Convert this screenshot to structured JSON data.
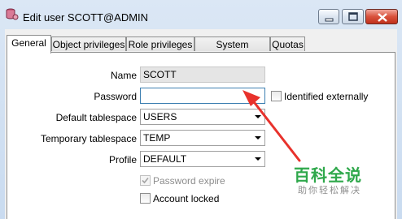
{
  "window": {
    "title": "Edit user SCOTT@ADMIN",
    "icon": "database-user-icon",
    "controls": [
      "minimize-icon",
      "maximize-icon",
      "close-icon"
    ]
  },
  "tabs": [
    {
      "label": "General",
      "active": true
    },
    {
      "label": "Object privileges",
      "active": false
    },
    {
      "label": "Role privileges",
      "active": false
    },
    {
      "label": "System privileges",
      "active": false
    },
    {
      "label": "Quotas",
      "active": false
    }
  ],
  "form": {
    "name_label": "Name",
    "name_value": "SCOTT",
    "password_label": "Password",
    "password_value": "",
    "identified_externally_label": "Identified externally",
    "identified_externally_checked": false,
    "default_tablespace_label": "Default tablespace",
    "default_tablespace_value": "USERS",
    "temporary_tablespace_label": "Temporary tablespace",
    "temporary_tablespace_value": "TEMP",
    "profile_label": "Profile",
    "profile_value": "DEFAULT",
    "password_expire_label": "Password expire",
    "password_expire_checked": true,
    "password_expire_enabled": false,
    "account_locked_label": "Account locked",
    "account_locked_checked": false
  },
  "annotation": {
    "arrow_color": "#e8322c"
  },
  "watermark": {
    "title": "百科全说",
    "subtitle": "助你轻松解决",
    "color": "#2fa84b"
  }
}
